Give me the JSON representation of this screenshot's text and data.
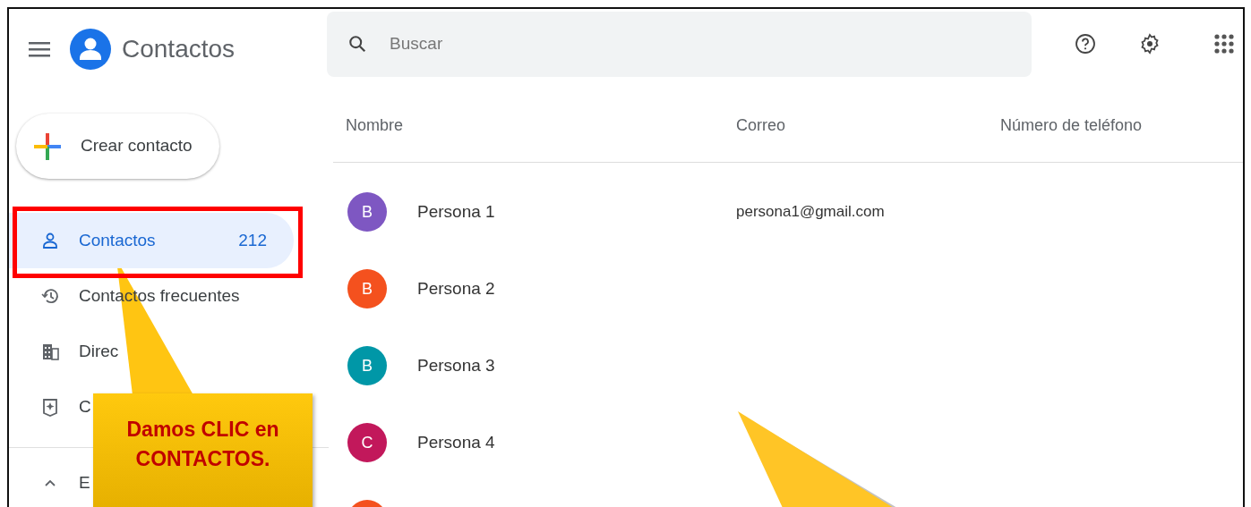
{
  "app": {
    "title": "Contactos"
  },
  "search": {
    "placeholder": "Buscar"
  },
  "create_button": {
    "label": "Crear contacto"
  },
  "sidebar": {
    "items": [
      {
        "kind": "contacts",
        "label": "Contactos",
        "count": "212",
        "selected": true
      },
      {
        "kind": "frequent",
        "label": "Contactos frecuentes",
        "selected": false
      },
      {
        "kind": "directory",
        "label": "Direc",
        "selected": false
      },
      {
        "kind": "other",
        "label": "C",
        "selected": false
      }
    ],
    "section": {
      "label": "E",
      "expanded": true
    }
  },
  "table": {
    "columns": [
      "Nombre",
      "Correo",
      "Número de teléfono"
    ],
    "rows": [
      {
        "initial": "B",
        "color": "#7e57c2",
        "name": "Persona 1",
        "email": "persona1@gmail.com"
      },
      {
        "initial": "B",
        "color": "#f4511e",
        "name": "Persona 2"
      },
      {
        "initial": "B",
        "color": "#0097a7",
        "name": "Persona 3"
      },
      {
        "initial": "C",
        "color": "#c2185b",
        "name": "Persona 4"
      },
      {
        "color": "#f4511e"
      }
    ]
  },
  "annotations": [
    {
      "kind": "frame"
    },
    {
      "kind": "callout",
      "text": "Damos CLIC en CONTACTOS."
    },
    {
      "kind": "pointer"
    }
  ]
}
